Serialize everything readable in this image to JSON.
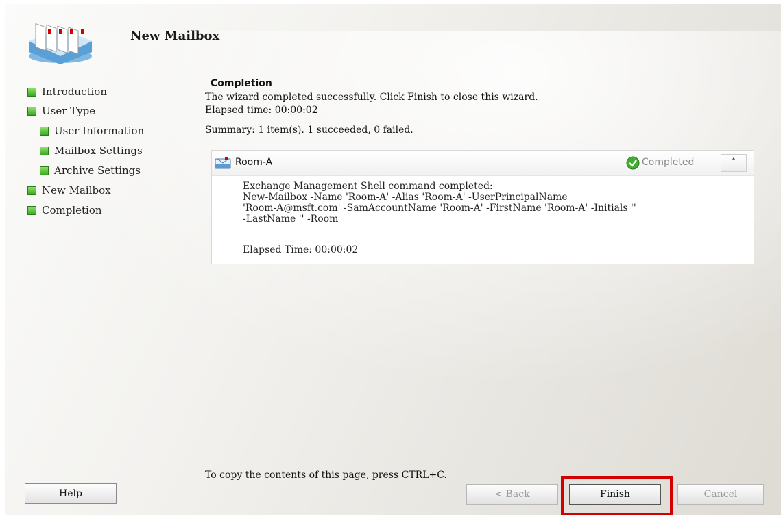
{
  "header": {
    "title": "New Mailbox",
    "icon": "mailbox-wizard-icon"
  },
  "nav": {
    "items": [
      {
        "label": "Introduction",
        "indent": 0
      },
      {
        "label": "User Type",
        "indent": 0
      },
      {
        "label": "User Information",
        "indent": 1
      },
      {
        "label": "Mailbox Settings",
        "indent": 1
      },
      {
        "label": "Archive Settings",
        "indent": 1
      },
      {
        "label": "New Mailbox",
        "indent": 0
      },
      {
        "label": "Completion",
        "indent": 0
      }
    ]
  },
  "content": {
    "heading": "Completion",
    "message": "The wizard completed successfully. Click Finish to close this wizard.",
    "elapsed": "Elapsed time: 00:00:02",
    "summary": "Summary: 1 item(s). 1 succeeded, 0 failed.",
    "item": {
      "name": "Room-A",
      "status": "Completed",
      "collapse_glyph": "˄",
      "command": "Exchange Management Shell command completed:\nNew-Mailbox -Name 'Room-A' -Alias 'Room-A' -UserPrincipalName\n'Room-A@msft.com' -SamAccountName 'Room-A' -FirstName 'Room-A' -Initials ''\n-LastName '' -Room",
      "elapsed": "Elapsed Time: 00:00:02"
    },
    "copy_hint": "To copy the contents of this page, press CTRL+C."
  },
  "buttons": {
    "help": "Help",
    "back": "< Back",
    "finish": "Finish",
    "cancel": "Cancel"
  },
  "colors": {
    "highlight": "#d40000",
    "nav_bullet": "#4cbb2e",
    "status_text": "#8a8a8a"
  }
}
